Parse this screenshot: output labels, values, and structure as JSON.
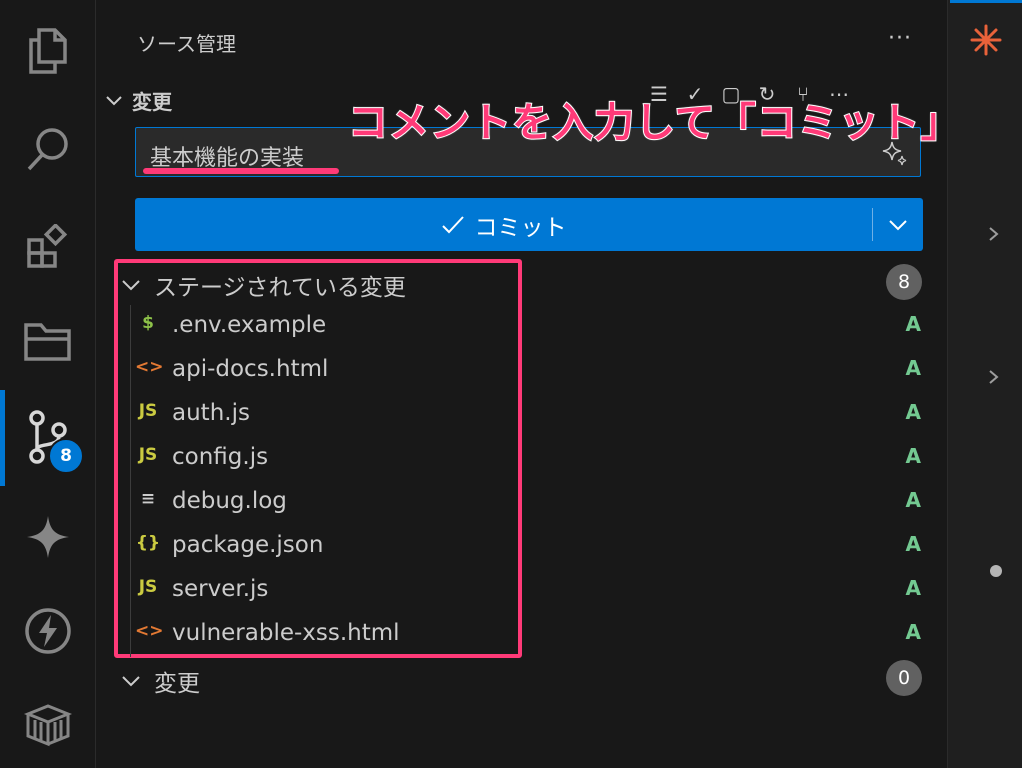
{
  "activity_bar": {
    "items": [
      "explorer-icon",
      "search-icon",
      "extensions-icon",
      "folders-icon",
      "source-control-icon",
      "sparkle-icon",
      "lightning-icon",
      "package-icon"
    ],
    "source_control_badge": "8"
  },
  "sidebar": {
    "title": "ソース管理",
    "more": "···",
    "section_label": "変更",
    "commit_message": "基本機能の実装",
    "commit_button_label": "コミット",
    "annotation": "コメントを入力して「コミット」",
    "staged_group": {
      "label": "ステージされている変更",
      "count": "8",
      "files": [
        {
          "icon": "$",
          "icon_color": "#8dc149",
          "name": ".env.example",
          "status": "A"
        },
        {
          "icon": "<>",
          "icon_color": "#e37933",
          "name": "api-docs.html",
          "status": "A"
        },
        {
          "icon": "JS",
          "icon_color": "#cbcb41",
          "name": "auth.js",
          "status": "A"
        },
        {
          "icon": "JS",
          "icon_color": "#cbcb41",
          "name": "config.js",
          "status": "A"
        },
        {
          "icon": "≡",
          "icon_color": "#cccccc",
          "name": "debug.log",
          "status": "A"
        },
        {
          "icon": "{}",
          "icon_color": "#cbcb41",
          "name": "package.json",
          "status": "A"
        },
        {
          "icon": "JS",
          "icon_color": "#cbcb41",
          "name": "server.js",
          "status": "A"
        },
        {
          "icon": "<>",
          "icon_color": "#e37933",
          "name": "vulnerable-xss.html",
          "status": "A"
        }
      ]
    },
    "changes_group": {
      "label": "変更",
      "count": "0"
    }
  },
  "colors": {
    "accent": "#0078d4",
    "highlight": "#ff3a78",
    "added": "#73c991"
  }
}
